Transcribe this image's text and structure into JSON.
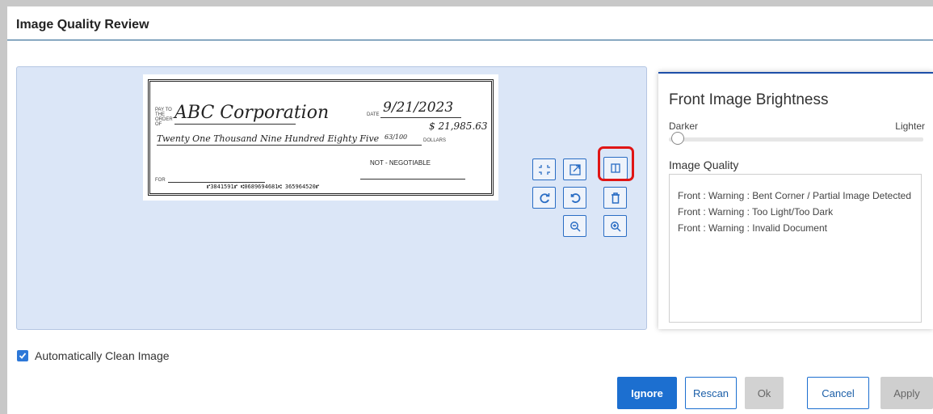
{
  "dialog": {
    "title": "Image Quality Review"
  },
  "check": {
    "pay_to_label": "PAY TO THE ORDER OF",
    "payee": "ABC Corporation",
    "date_label": "DATE",
    "date": "9/21/2023",
    "amount_numeric": "$ 21,985.63",
    "amount_words": "Twenty One Thousand Nine Hundred Eighty Five",
    "cents": "63/100",
    "dollars_label": "DOLLARS",
    "stamp": "NOT - NEGOTIABLE",
    "for_label": "FOR",
    "micr": "⑈3841591⑈ ⑆0689694681⑆ 365964520⑈"
  },
  "toolbar": {
    "buttons": [
      {
        "name": "fit-icon"
      },
      {
        "name": "open-external-icon"
      },
      {
        "name": "compare-icon",
        "highlighted": true
      },
      {
        "name": "rotate-right-icon"
      },
      {
        "name": "undo-icon"
      },
      {
        "name": "delete-icon"
      },
      {
        "name": "zoom-out-icon"
      },
      {
        "name": "zoom-in-icon"
      }
    ]
  },
  "panel": {
    "title": "Front Image Brightness",
    "slider_left_label": "Darker",
    "slider_right_label": "Lighter",
    "slider_value": 0.03,
    "image_quality_label": "Image Quality",
    "messages": [
      "Front : Warning : Bent Corner / Partial Image Detected",
      "Front : Warning : Too Light/Too Dark",
      "Front : Warning : Invalid Document"
    ]
  },
  "options": {
    "auto_clean_label": "Automatically Clean Image",
    "auto_clean_checked": true
  },
  "buttons": {
    "ignore": "Ignore",
    "rescan": "Rescan",
    "ok": "Ok",
    "cancel": "Cancel",
    "apply": "Apply"
  },
  "colors": {
    "accent": "#1c6fd0",
    "highlight": "#e01515",
    "viewer_bg": "#dbe6f7"
  }
}
